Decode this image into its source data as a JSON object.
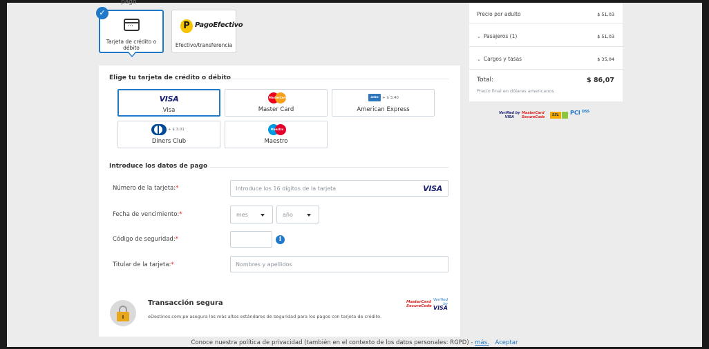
{
  "header": {
    "cut_text": "pago"
  },
  "payment_methods": {
    "card_label": "Tarjeta de crédito o débito",
    "pagoefectivo_brand": "PagoEfectivo",
    "pagoefectivo_p": "P",
    "pagoefectivo_label": "Efectivo/transferencia",
    "check_mark": "✓"
  },
  "card_section": {
    "title": "Elige tu tarjeta de crédito o débito",
    "brands": [
      {
        "name": "Visa",
        "logo_text": "VISA"
      },
      {
        "name": "Master Card",
        "logo_text": "MasterCard"
      },
      {
        "name": "American Express",
        "logo_text": "AMEX",
        "fee": "+ $ 3,40"
      },
      {
        "name": "Diners Club",
        "fee": "+ $ 3,01"
      },
      {
        "name": "Maestro",
        "logo_text": "Maestro"
      }
    ]
  },
  "payment_form": {
    "title": "Introduce los datos de pago",
    "required_mark": "*",
    "card_number_label": "Número de la tarjeta:",
    "card_number_placeholder": "Introduce los 16 dígitos de la tarjeta",
    "card_number_brand": "VISA",
    "expiry_label": "Fecha de vencimiento:",
    "month_value": "mes",
    "year_value": "año",
    "cvv_label": "Código de seguridad:",
    "info_glyph": "i",
    "holder_label": "Titular de la tarjeta:",
    "holder_placeholder": "Nombres y apellidos"
  },
  "secure": {
    "title": "Transacción segura",
    "text": "eDestinos.com.pe asegura los más altos estándares de seguridad para los pagos con tarjeta de crédito.",
    "mc_badge_line1": "MasterCard",
    "mc_badge_line2": "SecureCode",
    "visa_badge_line1": "Verified by",
    "visa_badge_line2": "VISA"
  },
  "summary": {
    "price_per_adult_label": "Precio por adulto",
    "price_per_adult_value": "$ 51,03",
    "passengers_label": "Pasajeros (1)",
    "passengers_value": "$ 51,03",
    "charges_label": "Cargos y tasas",
    "charges_value": "$ 35,04",
    "total_label": "Total:",
    "total_value": "$ 86,07",
    "total_note": "Precio final en dólares americanos",
    "chevron": "⌄"
  },
  "trust_badges": {
    "verified_visa_1": "Verified by",
    "verified_visa_2": "VISA",
    "mc_secure_1": "MasterCard",
    "mc_secure_2": "SecureCode",
    "ssl": "SSL",
    "pci": "PCI",
    "dss": "DSS"
  },
  "footer": {
    "text": "Conoce nuestra política de privacidad (también en el contexto de los datos personales: RGPD) -",
    "more_link": "más.",
    "accept_link": "Aceptar"
  },
  "colors": {
    "accent": "#1f78c8",
    "required": "#e0231e",
    "visa_blue": "#1a1f71"
  }
}
